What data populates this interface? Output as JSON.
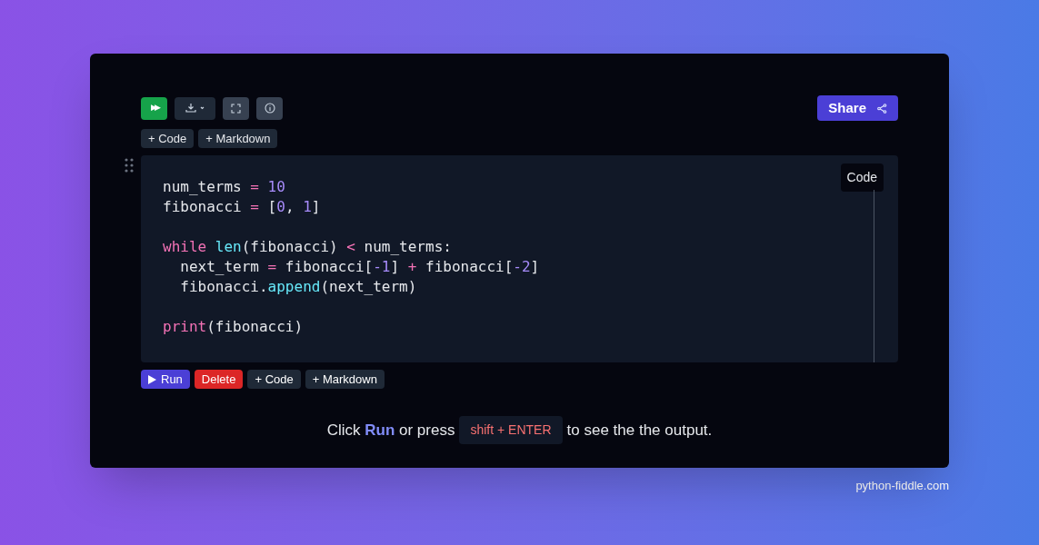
{
  "toolbar": {
    "run_all": "▶▶",
    "buttons": [
      {
        "kind": "download"
      },
      {
        "kind": "fullscreen"
      },
      {
        "kind": "info"
      }
    ],
    "share": "Share"
  },
  "add_top": [
    "+ Code",
    "+ Markdown"
  ],
  "cell": {
    "badge": "Code",
    "lines": [
      {
        "tokens": [
          {
            "text": "num_terms ",
            "kind": "plain"
          },
          {
            "text": "=",
            "kind": "operator"
          },
          {
            "text": " 10",
            "kind": "number"
          }
        ]
      },
      {
        "tokens": [
          {
            "text": "fibonacci ",
            "kind": "plain"
          },
          {
            "text": "=",
            "kind": "operator"
          },
          {
            "text": " [",
            "kind": "plain"
          },
          {
            "text": "0",
            "kind": "number"
          },
          {
            "text": ", ",
            "kind": "plain"
          },
          {
            "text": "1",
            "kind": "number"
          },
          {
            "text": "]",
            "kind": "plain"
          }
        ]
      },
      {
        "blank_before": true,
        "tokens": [
          {
            "text": "while ",
            "kind": "keyword"
          },
          {
            "text": "len",
            "kind": "builtin"
          },
          {
            "text": "(fibonacci) ",
            "kind": "plain"
          },
          {
            "text": "<",
            "kind": "operator"
          },
          {
            "text": " num_terms:",
            "kind": "plain"
          }
        ]
      },
      {
        "tokens": [
          {
            "text": "  next_term ",
            "kind": "plain"
          },
          {
            "text": "=",
            "kind": "operator"
          },
          {
            "text": " fibonacci[",
            "kind": "plain"
          },
          {
            "text": "-1",
            "kind": "number"
          },
          {
            "text": "] ",
            "kind": "plain"
          },
          {
            "text": "+",
            "kind": "operator"
          },
          {
            "text": " fibonacci[",
            "kind": "plain"
          },
          {
            "text": "-2",
            "kind": "number"
          },
          {
            "text": "]",
            "kind": "plain"
          }
        ]
      },
      {
        "tokens": [
          {
            "text": "  fibonacci.",
            "kind": "plain"
          },
          {
            "text": "append",
            "kind": "builtin"
          },
          {
            "text": "(next_term)",
            "kind": "plain"
          }
        ]
      },
      {
        "blank_before": true,
        "tokens": [
          {
            "text": "print",
            "kind": "keyword"
          },
          {
            "text": "(fibonacci)",
            "kind": "plain"
          }
        ]
      }
    ]
  },
  "cell_actions": [
    {
      "label": "Run",
      "kind": "run"
    },
    {
      "label": "Delete",
      "kind": "delete"
    },
    {
      "label": "+ Code",
      "kind": "add"
    },
    {
      "label": "+ Markdown",
      "kind": "add"
    }
  ],
  "hint": {
    "before": "Click **Run** or press",
    "key": "shift + ENTER",
    "after": "to see the the output."
  },
  "footer": "python-fiddle.com"
}
